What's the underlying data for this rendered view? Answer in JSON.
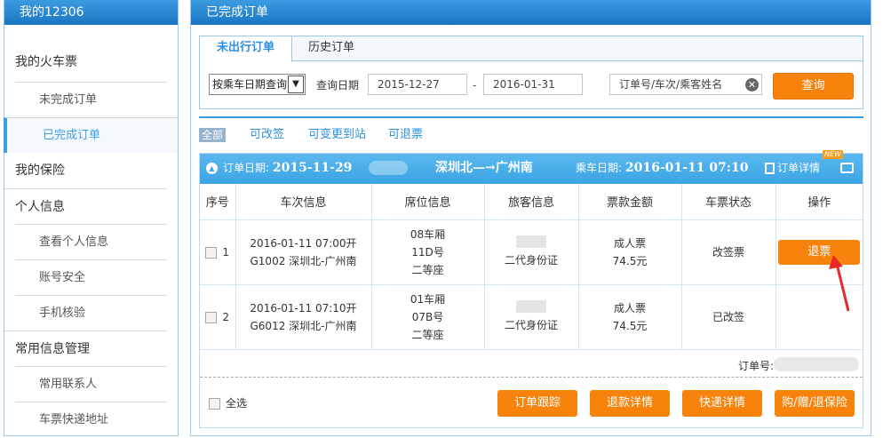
{
  "sidebar": {
    "title": "我的12306",
    "groups": {
      "train_tickets": "我的火车票",
      "unfinished_orders": "未完成订单",
      "completed_orders": "已完成订单",
      "insurance": "我的保险",
      "personal_info": "个人信息",
      "view_personal_info": "查看个人信息",
      "account_security": "账号安全",
      "phone_verify": "手机核验",
      "common_info": "常用信息管理",
      "contacts": "常用联系人",
      "delivery_address": "车票快递地址"
    }
  },
  "main": {
    "title": "已完成订单",
    "tabs": {
      "upcoming": "未出行订单",
      "history": "历史订单"
    },
    "query": {
      "mode_select": "按乘车日期查询",
      "date_label": "查询日期",
      "date_from": "2015-12-27",
      "date_sep": "-",
      "date_to": "2016-01-31",
      "keyword_placeholder": "订单号/车次/乘客姓名",
      "search_button": "查询"
    },
    "filters": {
      "all": "全部",
      "changeable": "可改签",
      "change_station": "可变更到站",
      "refundable": "可退票"
    },
    "order": {
      "order_date_label": "订单日期:",
      "order_date": "2015-11-29",
      "route": "深圳北—→广州南",
      "ride_date_label": "乘车日期:",
      "ride_date": "2016-01-11 07:10",
      "detail_link": "订单详情",
      "new_badge": "NEW",
      "columns": [
        "序号",
        "车次信息",
        "席位信息",
        "旅客信息",
        "票款金额",
        "车票状态",
        "操作"
      ],
      "rows": [
        {
          "index": "1",
          "train_time": "2016-01-11 07:00开",
          "train_route": "G1002 深圳北-广州南",
          "seat_car": "08车厢",
          "seat_no": "11D号",
          "seat_class": "二等座",
          "id_type": "二代身份证",
          "ticket_type": "成人票",
          "price": "74.5元",
          "status": "改签票",
          "action": "退票"
        },
        {
          "index": "2",
          "train_time": "2016-01-11 07:10开",
          "train_route": "G6012 深圳北-广州南",
          "seat_car": "01车厢",
          "seat_no": "07B号",
          "seat_class": "二等座",
          "id_type": "二代身份证",
          "ticket_type": "成人票",
          "price": "74.5元",
          "status": "已改签",
          "action": ""
        }
      ],
      "order_no_label": "订单号:",
      "select_all": "全选",
      "buttons": {
        "track": "订单跟踪",
        "refund_detail": "退款详情",
        "express_detail": "快递详情",
        "insurance": "购/赠/退保险"
      }
    }
  },
  "colors": {
    "header_blue": "#1a76c4",
    "accent_orange": "#f7820c",
    "link_blue": "#2e8fe0",
    "arrow_red": "#e8282b"
  }
}
